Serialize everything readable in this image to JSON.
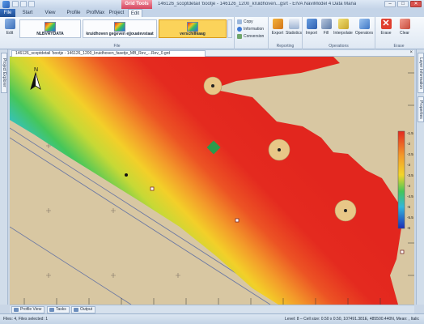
{
  "window": {
    "title": "146126_scoptdetail 'bootje - 146126_1200_kruidhoven...gsrt - EIVA NaviModel 4 Data Manager",
    "context_tab_header": "Grid Tools",
    "controls": {
      "minimize": "–",
      "maximize": "□",
      "close": "✕"
    }
  },
  "tabs": [
    {
      "label": "File",
      "active": false
    },
    {
      "label": "Start",
      "active": false
    },
    {
      "label": "View",
      "active": false
    },
    {
      "label": "Profile",
      "active": false
    },
    {
      "label": "ProfMax",
      "active": false
    },
    {
      "label": "Project",
      "active": false
    },
    {
      "label": "Edit",
      "active": true
    }
  ],
  "ribbon": {
    "file_group": {
      "label": "File",
      "edit_label": "Edit",
      "gallery": [
        "NLBVRYDATA",
        "kruidhoven gegeven ejjouatevstaat",
        "verschillkaag"
      ]
    },
    "clipboard": {
      "copy": "Copy",
      "information": "Information",
      "conversion": "Conversion"
    },
    "reporting": {
      "label": "Reporting",
      "export": "Export",
      "statistics": "Statistics"
    },
    "operations": {
      "label": "Operations",
      "import": "Import",
      "fill": "Fill",
      "interpolate": "Interpolate",
      "operators": "Operators"
    },
    "erase": {
      "label": "Erase",
      "erase": "Erase",
      "clear": "Clear"
    }
  },
  "side_panels": {
    "left": "Project Explorer",
    "right_1": "Layer Information",
    "right_2": "Properties"
  },
  "document_tab": {
    "label": "146126_scoptdetail 'bootje - 146126_1200_kruidhoven_fasetje_MB_Rev_...Rev_0.grd",
    "close": "×"
  },
  "map": {
    "coord_label_left": "N",
    "colorbar_ticks": [
      "-1.5",
      "-2",
      "-2.5",
      "-3",
      "-3.5",
      "-4",
      "-4.5",
      "-5",
      "-5.5",
      "-6"
    ],
    "colors": {
      "sand": "#d8c7a2",
      "deep": "#e42a1f",
      "mid": "#f4d12a",
      "shallow": "#2b63d8",
      "line": "#6d7aa3"
    }
  },
  "bottom_tabs": [
    "Profile View",
    "Tasks",
    "Output"
  ],
  "status": {
    "left": "Files: 4, Files selected: 1",
    "right": "Level: 8 – Cell size: 0.50 x 0.50, 107491.381E, 485500.440N, Mean: , Italic"
  }
}
